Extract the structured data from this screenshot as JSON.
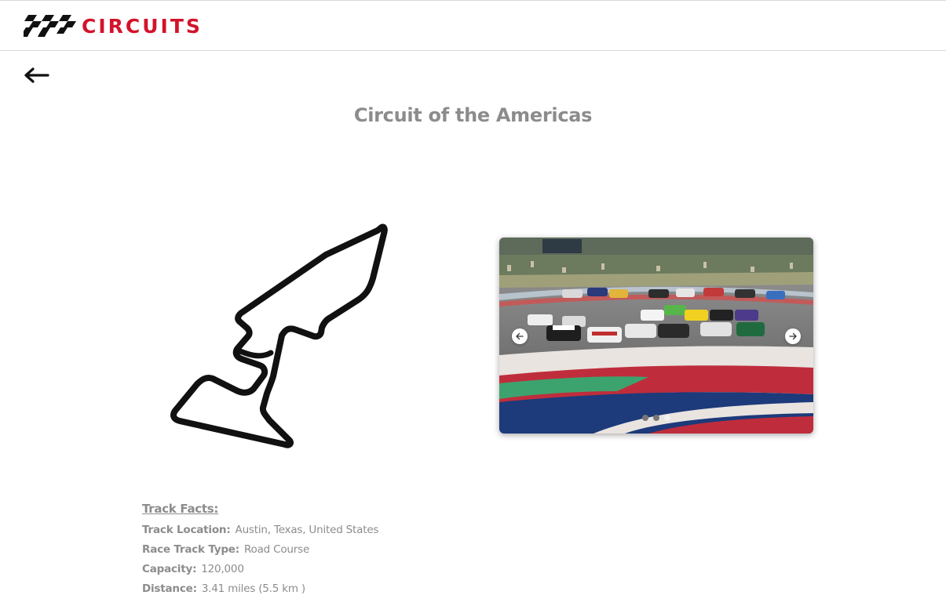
{
  "header": {
    "logo_text": "CIRCUITS",
    "logo_flag_icon": "checkered-flag-icon",
    "brand_color": "#d3132b"
  },
  "back_button": {
    "icon": "arrow-left-icon"
  },
  "page": {
    "title": "Circuit of the Americas"
  },
  "track_map": {
    "icon": "track-outline-icon"
  },
  "carousel": {
    "prev_icon": "arrow-left-circle-icon",
    "next_icon": "arrow-right-circle-icon",
    "slide_count": 3,
    "active_slide": 3
  },
  "track_facts": {
    "heading": "Track Facts:",
    "rows": [
      {
        "label": "Track Location:",
        "value": "Austin, Texas, United States"
      },
      {
        "label": "Race Track Type:",
        "value": "Road Course"
      },
      {
        "label": "Capacity:",
        "value": "120,000"
      },
      {
        "label": "Distance:",
        "value": "3.41 miles (5.5 km )"
      }
    ]
  },
  "colors": {
    "title_gray": "#8c8c8c",
    "accent_red": "#d3132b",
    "track_blue": "#1d3a7a"
  }
}
